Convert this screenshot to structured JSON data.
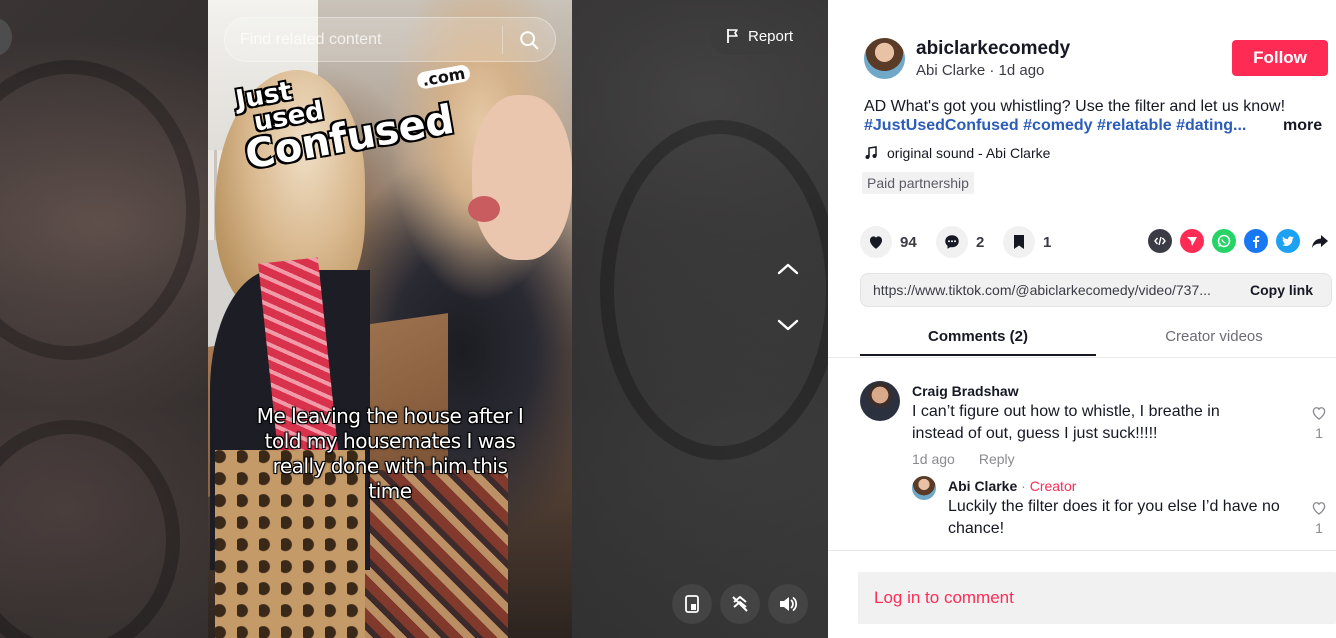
{
  "video": {
    "search_placeholder": "Find related content",
    "report_label": "Report",
    "overlay_logo": {
      "line1": "Just",
      "line2": "used",
      "line3": "Confused",
      "line4": ".com"
    },
    "caption": "Me leaving the house after I told my housemates I was really done with him this time"
  },
  "author": {
    "username": "abiclarkecomedy",
    "display_name": "Abi Clarke",
    "posted": "1d ago",
    "subline": "Abi Clarke · 1d ago",
    "follow_label": "Follow"
  },
  "post": {
    "description": "AD What's got you whistling? Use the filter and let us know!",
    "hashtags": "#JustUsedConfused #comedy #relatable #dating...",
    "more_label": "more",
    "sound": "original sound - Abi Clarke",
    "paid_label": "Paid partnership"
  },
  "stats": {
    "likes": "94",
    "comments": "2",
    "saves": "1"
  },
  "share_icons": [
    "embed-icon",
    "send-icon",
    "whatsapp-icon",
    "facebook-icon",
    "twitter-icon",
    "share-arrow-icon"
  ],
  "link": {
    "url": "https://www.tiktok.com/@abiclarkecomedy/video/737...",
    "copy_label": "Copy link"
  },
  "tabs": [
    {
      "label": "Comments (2)",
      "active": true
    },
    {
      "label": "Creator videos",
      "active": false
    }
  ],
  "comments": [
    {
      "name": "Craig Bradshaw",
      "text": "I can’t figure out how to whistle, I breathe in instead of out, guess I just suck!!!!!",
      "time": "1d ago",
      "reply_label": "Reply",
      "likes": "1"
    },
    {
      "name": "Abi Clarke",
      "tag": "Creator",
      "text": "Luckily the filter does it for you else I’d have no chance!",
      "likes": "1"
    }
  ],
  "login_label": "Log in to comment",
  "colors": {
    "accent": "#fe2c55",
    "hashtag": "#2b5db9",
    "whatsapp": "#25d366",
    "facebook": "#1877f2",
    "twitter": "#1da1f2",
    "send": "#fe2c55",
    "embed": "#3b3b45"
  }
}
